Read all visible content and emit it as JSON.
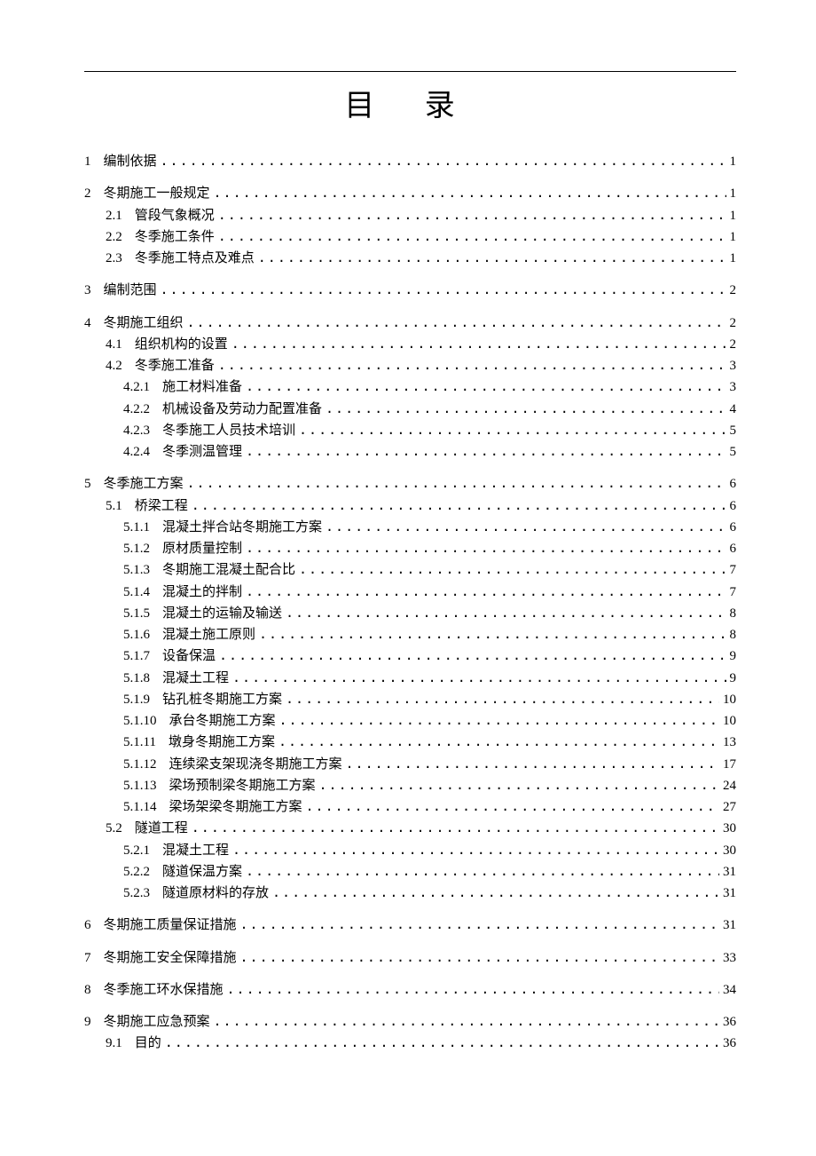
{
  "title": "目 录",
  "toc": [
    {
      "level": 1,
      "num": "1",
      "text": "编制依据",
      "page": "1"
    },
    {
      "level": 1,
      "num": "2",
      "text": "冬期施工一般规定",
      "page": "1"
    },
    {
      "level": 2,
      "num": "2.1",
      "text": "管段气象概况",
      "page": "1"
    },
    {
      "level": 2,
      "num": "2.2",
      "text": "冬季施工条件",
      "page": "1"
    },
    {
      "level": 2,
      "num": "2.3",
      "text": "冬季施工特点及难点",
      "page": "1"
    },
    {
      "level": 1,
      "num": "3",
      "text": "编制范围",
      "page": "2"
    },
    {
      "level": 1,
      "num": "4",
      "text": "冬期施工组织",
      "page": "2"
    },
    {
      "level": 2,
      "num": "4.1",
      "text": "组织机构的设置",
      "page": "2"
    },
    {
      "level": 2,
      "num": "4.2",
      "text": "冬季施工准备",
      "page": "3"
    },
    {
      "level": 3,
      "num": "4.2.1",
      "text": "施工材料准备",
      "page": "3"
    },
    {
      "level": 3,
      "num": "4.2.2",
      "text": "机械设备及劳动力配置准备",
      "page": "4"
    },
    {
      "level": 3,
      "num": "4.2.3",
      "text": "冬季施工人员技术培训",
      "page": "5"
    },
    {
      "level": 3,
      "num": "4.2.4",
      "text": "冬季测温管理",
      "page": "5"
    },
    {
      "level": 1,
      "num": "5",
      "text": "冬季施工方案",
      "page": "6"
    },
    {
      "level": 2,
      "num": "5.1",
      "text": "桥梁工程",
      "page": "6"
    },
    {
      "level": 3,
      "num": "5.1.1",
      "text": "混凝土拌合站冬期施工方案",
      "page": "6"
    },
    {
      "level": 3,
      "num": "5.1.2",
      "text": "原材质量控制",
      "page": "6"
    },
    {
      "level": 3,
      "num": "5.1.3",
      "text": "冬期施工混凝土配合比",
      "page": "7"
    },
    {
      "level": 3,
      "num": "5.1.4",
      "text": "混凝土的拌制",
      "page": "7"
    },
    {
      "level": 3,
      "num": "5.1.5",
      "text": "混凝土的运输及输送",
      "page": "8"
    },
    {
      "level": 3,
      "num": "5.1.6",
      "text": "混凝土施工原则",
      "page": "8"
    },
    {
      "level": 3,
      "num": "5.1.7",
      "text": "设备保温",
      "page": "9"
    },
    {
      "level": 3,
      "num": "5.1.8",
      "text": "混凝土工程",
      "page": "9"
    },
    {
      "level": 3,
      "num": "5.1.9",
      "text": "钻孔桩冬期施工方案",
      "page": "10"
    },
    {
      "level": 3,
      "num": "5.1.10",
      "text": "承台冬期施工方案",
      "page": "10"
    },
    {
      "level": 3,
      "num": "5.1.11",
      "text": "墩身冬期施工方案",
      "page": "13"
    },
    {
      "level": 3,
      "num": "5.1.12",
      "text": "连续梁支架现浇冬期施工方案",
      "page": "17"
    },
    {
      "level": 3,
      "num": "5.1.13",
      "text": "梁场预制梁冬期施工方案",
      "page": "24"
    },
    {
      "level": 3,
      "num": "5.1.14",
      "text": "梁场架梁冬期施工方案",
      "page": "27"
    },
    {
      "level": 2,
      "num": "5.2",
      "text": "隧道工程",
      "page": "30"
    },
    {
      "level": 3,
      "num": "5.2.1",
      "text": "混凝土工程",
      "page": "30"
    },
    {
      "level": 3,
      "num": "5.2.2",
      "text": "隧道保温方案",
      "page": "31"
    },
    {
      "level": 3,
      "num": "5.2.3",
      "text": "隧道原材料的存放",
      "page": "31"
    },
    {
      "level": 1,
      "num": "6",
      "text": "冬期施工质量保证措施",
      "page": "31"
    },
    {
      "level": 1,
      "num": "7",
      "text": "冬期施工安全保障措施",
      "page": "33"
    },
    {
      "level": 1,
      "num": "8",
      "text": "冬季施工环水保措施",
      "page": "34"
    },
    {
      "level": 1,
      "num": "9",
      "text": "冬期施工应急预案",
      "page": "36"
    },
    {
      "level": 2,
      "num": "9.1",
      "text": "目的",
      "page": "36"
    }
  ]
}
